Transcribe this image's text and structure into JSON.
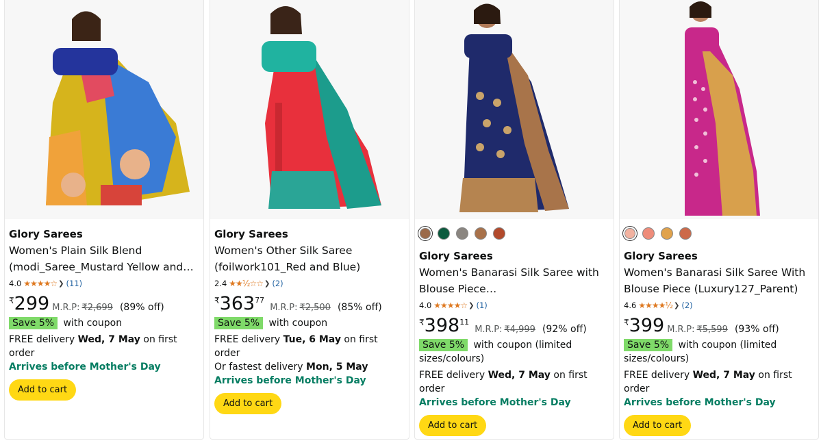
{
  "products": [
    {
      "brand": "Glory Sarees",
      "title_line1": "Women's Plain Silk Blend",
      "title_line2": "(modi_Saree_Mustard Yellow and…",
      "rating": "4.0",
      "stars": "★★★★☆",
      "review_count": "(11)",
      "currency": "₹",
      "price_whole": "299",
      "price_fraction": "",
      "mrp_label": "M.R.P:",
      "mrp": "₹2,699",
      "discount": "(89% off)",
      "coupon_badge": "Save 5%",
      "coupon_text": "with coupon",
      "delivery_prefix": "FREE delivery ",
      "delivery_date": "Wed, 7 May",
      "delivery_suffix": " on first order",
      "fastest_prefix": "",
      "fastest_date": "",
      "arrives": "Arrives before Mother's Day",
      "cart_label": "Add to cart"
    },
    {
      "brand": "Glory Sarees",
      "title_line1": "Women's Other Silk Saree",
      "title_line2": "(foilwork101_Red and Blue)",
      "rating": "2.4",
      "stars": "★★½☆☆",
      "review_count": "(2)",
      "currency": "₹",
      "price_whole": "363",
      "price_fraction": "77",
      "mrp_label": "M.R.P:",
      "mrp": "₹2,500",
      "discount": "(85% off)",
      "coupon_badge": "Save 5%",
      "coupon_text": "with coupon",
      "delivery_prefix": "FREE delivery ",
      "delivery_date": "Tue, 6 May",
      "delivery_suffix": " on first order",
      "fastest_prefix": "Or fastest delivery ",
      "fastest_date": "Mon, 5 May",
      "arrives": "Arrives before Mother's Day",
      "cart_label": "Add to cart"
    },
    {
      "brand": "Glory Sarees",
      "title_line1": "Women's Banarasi Silk Saree with",
      "title_line2": "Blouse Piece…",
      "rating": "4.0",
      "stars": "★★★★☆",
      "review_count": "(1)",
      "currency": "₹",
      "price_whole": "398",
      "price_fraction": "11",
      "mrp_label": "M.R.P:",
      "mrp": "₹4,999",
      "discount": "(92% off)",
      "coupon_badge": "Save 5%",
      "coupon_text": "with coupon (limited",
      "coupon_text2": "sizes/colours)",
      "delivery_prefix": "FREE delivery ",
      "delivery_date": "Wed, 7 May",
      "delivery_suffix": " on first order",
      "arrives": "Arrives before Mother's Day",
      "cart_label": "Add to cart",
      "swatches": [
        "#9b6a4a",
        "#0d5a3e",
        "#8a8580",
        "#a8714a",
        "#b24a2c"
      ]
    },
    {
      "brand": "Glory Sarees",
      "title_line1": "Women's Banarasi Silk Saree With",
      "title_line2": "Blouse Piece (Luxury127_Parent)",
      "rating": "4.6",
      "stars": "★★★★½",
      "review_count": "(2)",
      "currency": "₹",
      "price_whole": "399",
      "price_fraction": "",
      "mrp_label": "M.R.P:",
      "mrp": "₹5,599",
      "discount": "(93% off)",
      "coupon_badge": "Save 5%",
      "coupon_text": "with coupon (limited",
      "coupon_text2": "sizes/colours)",
      "delivery_prefix": "FREE delivery ",
      "delivery_date": "Wed, 7 May",
      "delivery_suffix": " on first order",
      "arrives": "Arrives before Mother's Day",
      "cart_label": "Add to cart",
      "swatches": [
        "#f2b2a0",
        "#ee8c7a",
        "#e0a24c",
        "#cc6a4a"
      ]
    }
  ],
  "colors": {
    "star": "#de7921",
    "link": "#2162a1",
    "coupon_green": "#7fda69",
    "arrives_green": "#067d62",
    "cart_yellow": "#ffd814"
  }
}
